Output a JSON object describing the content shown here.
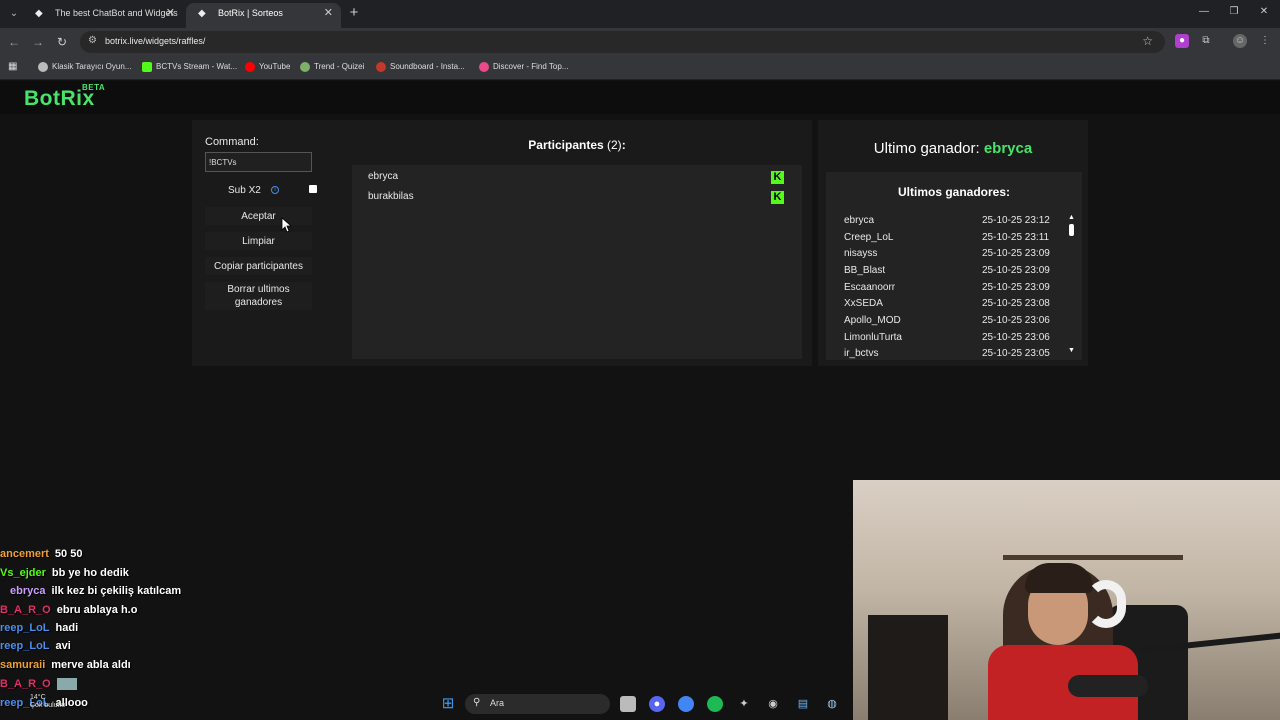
{
  "browser": {
    "tabs": [
      {
        "title": "The best ChatBot and Widgets",
        "active": false
      },
      {
        "title": "BotRix | Sorteos",
        "active": true
      }
    ],
    "url": "botrix.live/widgets/raffles/",
    "bookmarks": [
      {
        "label": "Klasik Tarayıcı Oyun...",
        "color": "#bbbbbb"
      },
      {
        "label": "BCTVs Stream - Wat...",
        "color": "#53fc18"
      },
      {
        "label": "YouTube",
        "color": "#ff0000"
      },
      {
        "label": "Trend - Quizei",
        "color": "#7fb069"
      },
      {
        "label": "Soundboard - Insta...",
        "color": "#c0392b"
      },
      {
        "label": "Discover - Find Top...",
        "color": "#e84a8c"
      }
    ]
  },
  "app": {
    "logo": "BotRix",
    "logo_badge": "BETA"
  },
  "raffle": {
    "command_label": "Command:",
    "command_value": "!BCTVs",
    "sub_label": "Sub X2",
    "buttons": {
      "accept": "Aceptar",
      "clear": "Limpiar",
      "copy": "Copiar participantes",
      "delete_last": "Borrar ultimos ganadores"
    },
    "participants_label": "Participantes",
    "participants_count": "(2)",
    "participants_suffix": ":",
    "participants": [
      {
        "name": "ebryca",
        "platform_icon": "kick-icon"
      },
      {
        "name": "burakbilas",
        "platform_icon": "kick-icon"
      }
    ]
  },
  "winner": {
    "label": "Ultimo ganador:",
    "name": "ebryca",
    "history_title": "Ultimos ganadores:",
    "history": [
      {
        "name": "ebryca",
        "date": "25-10-25 23:12"
      },
      {
        "name": "Creep_LoL",
        "date": "25-10-25 23:11"
      },
      {
        "name": "nisayss",
        "date": "25-10-25 23:09"
      },
      {
        "name": "BB_Blast",
        "date": "25-10-25 23:09"
      },
      {
        "name": "Escaanoorr",
        "date": "25-10-25 23:09"
      },
      {
        "name": "XxSEDA",
        "date": "25-10-25 23:08"
      },
      {
        "name": "Apollo_MOD",
        "date": "25-10-25 23:06"
      },
      {
        "name": "LimonluTurta",
        "date": "25-10-25 23:06"
      },
      {
        "name": "ir_bctvs",
        "date": "25-10-25 23:05"
      }
    ]
  },
  "chat": [
    {
      "user": "ancemert",
      "message": "50 50",
      "color": "#f0a030"
    },
    {
      "user": "Vs_ejder",
      "message": "bb ye ho dedik",
      "color": "#53fc18"
    },
    {
      "user": "ebryca",
      "message": "ilk kez bi çekiliş katılcam",
      "color": "#c9a0ff"
    },
    {
      "user": "B_A_R_O",
      "message": "ebru ablaya h.o",
      "color": "#e0306a"
    },
    {
      "user": "reep_LoL",
      "message": "hadi",
      "color": "#4a8ef0"
    },
    {
      "user": "reep_LoL",
      "message": "avi",
      "color": "#4a8ef0"
    },
    {
      "user": "samuraii",
      "message": "merve abla aldı",
      "color": "#f0a030"
    },
    {
      "user": "B_A_R_O",
      "message": "",
      "color": "#e0306a"
    },
    {
      "user": "reep_LoL",
      "message": "allooo",
      "color": "#4a8ef0"
    }
  ],
  "taskbar": {
    "search_placeholder": "Ara",
    "weather_temp": "14°C",
    "weather_desc": "Çok bulutlu"
  }
}
